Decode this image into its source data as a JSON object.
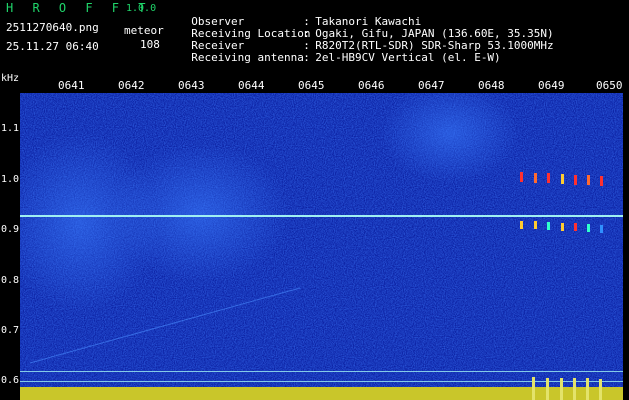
{
  "header": {
    "brand": "H R O F F T",
    "version": "1.0.0",
    "filename": "2511270640.png",
    "timestamp": "25.11.27 06:40",
    "detect_kind": "meteor",
    "detect_count": "108"
  },
  "info": [
    {
      "label": "Observer",
      "value": "Takanori Kawachi"
    },
    {
      "label": "Receiving Location",
      "value": "Ogaki, Gifu, JAPAN (136.60E, 35.35N)"
    },
    {
      "label": "Receiver",
      "value": "R820T2(RTL-SDR) SDR-Sharp 53.1000MHz"
    },
    {
      "label": "Receiving antenna",
      "value": "2el-HB9CV Vertical (el. E-W)"
    }
  ],
  "plot": {
    "unit": "kHz",
    "minute_ticks": [
      "0641",
      "0642",
      "0643",
      "0644",
      "0645",
      "0646",
      "0647",
      "0648",
      "0649",
      "0650"
    ],
    "freq_ticks": [
      "1.1",
      "1.0",
      "0.9",
      "0.8",
      "0.7",
      "0.6"
    ],
    "colors": {
      "background": "#0a1ea0",
      "carrier": "#9feff2",
      "tick_label": "#ffffff",
      "brand": "#1fd56a"
    }
  }
}
